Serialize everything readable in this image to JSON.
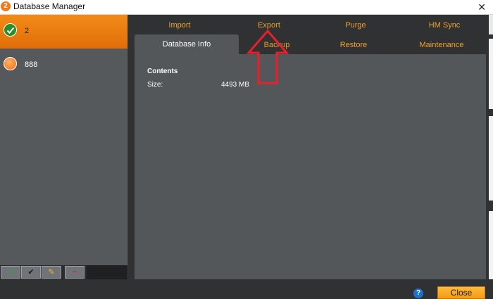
{
  "window": {
    "title": "Database Manager",
    "close_glyph": "✕",
    "app_icon_glyph": "2"
  },
  "databases": [
    {
      "name": "2",
      "status": "selected",
      "icon": "check-icon"
    },
    {
      "name": "888",
      "status": "normal",
      "icon": "dot-icon"
    }
  ],
  "toolbar": {
    "add_glyph": "+",
    "check_glyph": "✔",
    "edit_glyph": "✎",
    "remove_glyph": "−"
  },
  "tabs_top": [
    "Import",
    "Export",
    "Purge",
    "HM Sync"
  ],
  "tabs_bottom": [
    "Database Info",
    "Backup",
    "Restore",
    "Maintenance"
  ],
  "active_tab": "Database Info",
  "info": {
    "section": "Contents",
    "size_label": "Size:",
    "size_value": "4493 MB"
  },
  "footer": {
    "help_glyph": "?",
    "close_label": "Close"
  },
  "colors": {
    "accent": "#f2a02a",
    "selected": "#f08a18",
    "annotation_arrow": "#e8202a"
  }
}
